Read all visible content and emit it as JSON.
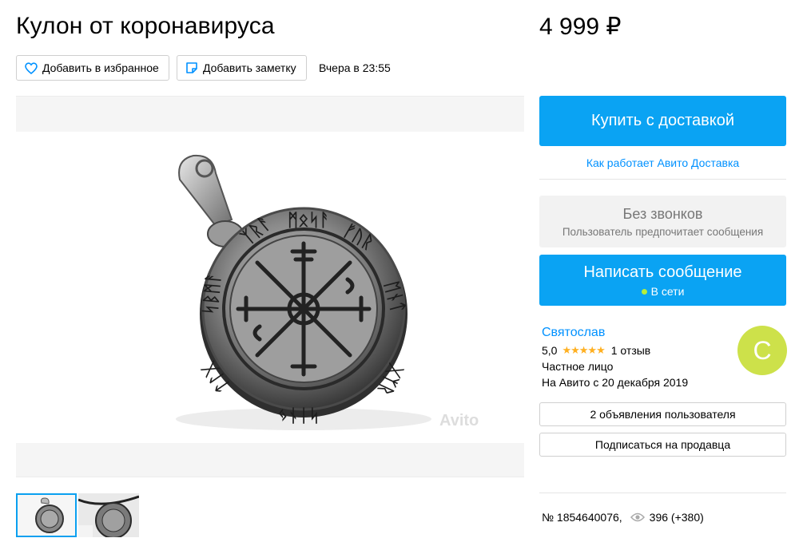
{
  "title": "Кулон от коронавируса",
  "price": "4 999 ₽",
  "actions": {
    "favorite_label": "Добавить в избранное",
    "note_label": "Добавить заметку",
    "posted": "Вчера в 23:55"
  },
  "gallery": {
    "watermark": "Avito",
    "thumbnail_count": 2,
    "active_thumbnail": 1
  },
  "purchase": {
    "buy_label": "Купить с доставкой",
    "delivery_link": "Как работает Авито Доставка"
  },
  "contact": {
    "no_calls_title": "Без звонков",
    "no_calls_subtitle": "Пользователь предпочитает сообщения",
    "message_label": "Написать сообщение",
    "online_status": "В сети"
  },
  "seller": {
    "name": "Святослав",
    "rating": "5,0",
    "stars": "★★★★★",
    "reviews": "1 отзыв",
    "type": "Частное лицо",
    "since": "На Авито с 20 декабря 2019",
    "avatar_letter": "С",
    "ads_button": "2 объявления пользователя",
    "subscribe_button": "Подписаться на продавца"
  },
  "meta": {
    "item_number": "№ 1854640076,",
    "views": "396 (+380)"
  },
  "colors": {
    "accent_blue": "#0aa3f3",
    "link_blue": "#0091ff",
    "avatar_bg": "#cde14a",
    "star": "#ffb021",
    "online_dot": "#b4ee3b"
  },
  "icons": [
    "heart-icon",
    "note-icon",
    "eye-icon",
    "online-dot-icon",
    "avito-logo-icon"
  ]
}
